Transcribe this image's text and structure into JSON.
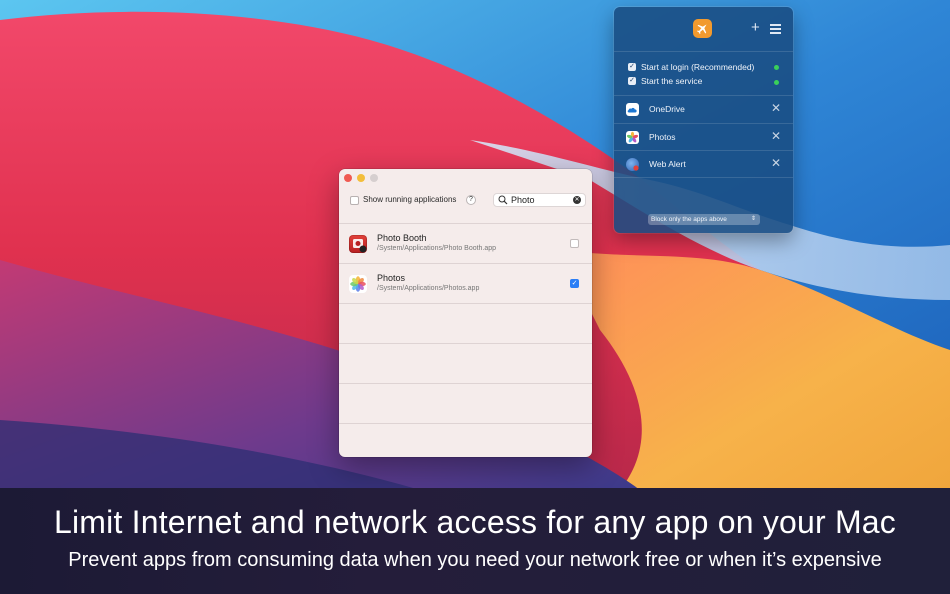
{
  "banner": {
    "headline": "Limit Internet and network access for any app on your Mac",
    "subline": "Prevent apps from consuming data when you need your network free or when it’s expensive"
  },
  "window": {
    "show_running_label": "Show running applications",
    "help_label": "?",
    "search": {
      "value": "Photo"
    },
    "apps": [
      {
        "name": "Photo Booth",
        "path": "/System/Applications/Photo Booth.app",
        "checked": false
      },
      {
        "name": "Photos",
        "path": "/System/Applications/Photos.app",
        "checked": true
      }
    ]
  },
  "popover": {
    "options": [
      {
        "label": "Start at login (Recommended)",
        "checked": true
      },
      {
        "label": "Start the service",
        "checked": true
      }
    ],
    "blocked_apps": [
      {
        "name": "OneDrive",
        "icon": "onedrive-icon"
      },
      {
        "name": "Photos",
        "icon": "photos-icon"
      },
      {
        "name": "Web Alert",
        "icon": "web-alert-icon"
      }
    ],
    "mode": {
      "selected": "Block only the apps above"
    }
  },
  "colors": {
    "accent_blue": "#2b7ef6",
    "status_green": "#3ad05a",
    "logo_orange": "#f29a2e"
  }
}
